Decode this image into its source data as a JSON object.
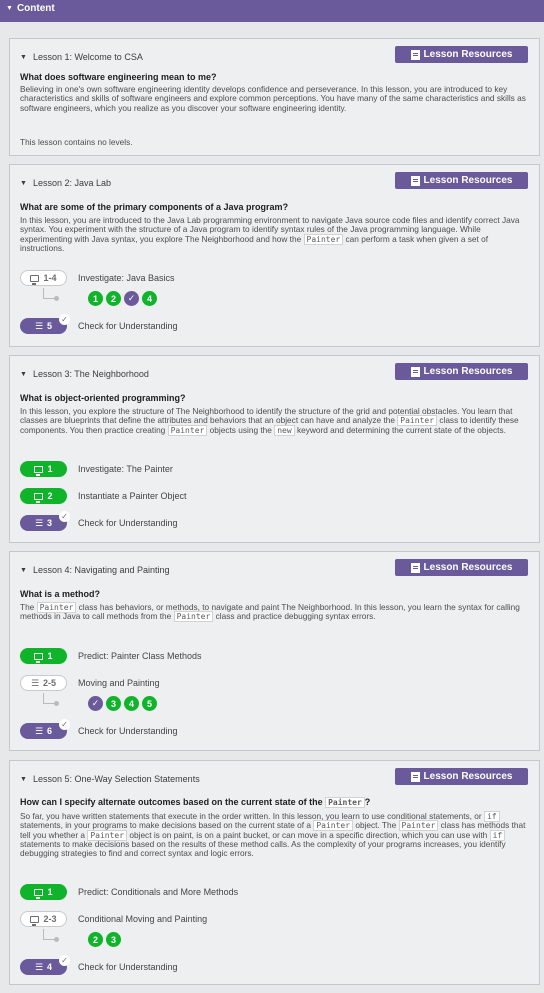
{
  "content_label": "Content",
  "resources_label": "Lesson Resources",
  "lessons": [
    {
      "title": "Lesson 1: Welcome to CSA",
      "question": "What does software engineering mean to me?",
      "description": "Believing in one's own software engineering identity develops confidence and perseverance. In this lesson, you are introduced to key characteristics and skills of software engineers and explore common perceptions. You have many of the same characteristics and skills as software engineers, which you realize as you discover your software engineering identity.",
      "no_levels": "This lesson contains no levels."
    },
    {
      "title": "Lesson 2: Java Lab",
      "question": "What are some of the primary components of a Java program?",
      "desc_a": "In this lesson, you are introduced to the Java Lab programming environment to navigate Java source code files and identify correct Java syntax. You experiment with the structure of a Java program to identify syntax rules of the Java programming language. While experimenting with Java syntax, you explore The Neighborhood and how the ",
      "code_a": "Painter",
      "desc_b": " can perform a task when given a set of instructions.",
      "levels": [
        {
          "badge": "1-4",
          "label": "Investigate: Java Basics"
        },
        {
          "badge": "5",
          "label": "Check for Understanding"
        }
      ],
      "bubbles": [
        "1",
        "2",
        "✓",
        "4"
      ]
    },
    {
      "title": "Lesson 3: The Neighborhood",
      "question": "What is object-oriented programming?",
      "desc_a": "In this lesson, you explore the structure of The Neighborhood to identify the structure of the grid and potential obstacles. You learn that classes are blueprints that define the attributes and behaviors that an object can have and analyze the ",
      "code_a": "Painter",
      "desc_b": " class to identify these components. You then practice creating ",
      "code_b": "Painter",
      "desc_c": " objects using the ",
      "code_c": "new",
      "desc_d": " keyword and determining the current state of the objects.",
      "levels": [
        {
          "badge": "1",
          "label": "Investigate: The Painter"
        },
        {
          "badge": "2",
          "label": "Instantiate a Painter Object"
        },
        {
          "badge": "3",
          "label": "Check for Understanding"
        }
      ]
    },
    {
      "title": "Lesson 4: Navigating and Painting",
      "question": "What is a method?",
      "desc_a": "The ",
      "code_a": "Painter",
      "desc_b": " class has behaviors, or methods, to navigate and paint The Neighborhood. In this lesson, you learn the syntax for calling methods in Java to call methods from the ",
      "code_b": "Painter",
      "desc_c": " class and practice debugging syntax errors.",
      "levels": [
        {
          "badge": "1",
          "label": "Predict: Painter Class Methods"
        },
        {
          "badge": "2-5",
          "label": "Moving and Painting"
        },
        {
          "badge": "6",
          "label": "Check for Understanding"
        }
      ],
      "bubbles": [
        "✓",
        "3",
        "4",
        "5"
      ]
    },
    {
      "title": "Lesson 5: One-Way Selection Statements",
      "question_a": "How can I specify alternate outcomes based on the current state of the ",
      "question_code": "Painter",
      "question_b": "?",
      "desc_a": "So far, you have written statements that execute in the order written. In this lesson, you learn to use conditional statements, or ",
      "code_a": "if",
      "desc_b": " statements, in your programs to make decisions based on the current state of a ",
      "code_b": "Painter",
      "desc_c": " object. The ",
      "code_c": "Painter",
      "desc_d": " class has methods that tell you whether a ",
      "code_d": "Painter",
      "desc_e": " object is on paint, is on a paint bucket, or can move in a specific direction, which you can use with ",
      "code_e": "if",
      "desc_f": " statements to make decisions based on the results of these method calls. As the complexity of your programs increases, you identify debugging strategies to find and correct syntax and logic errors.",
      "levels": [
        {
          "badge": "1",
          "label": "Predict: Conditionals and More Methods"
        },
        {
          "badge": "2-3",
          "label": "Conditional Moving and Painting"
        },
        {
          "badge": "4",
          "label": "Check for Understanding"
        }
      ],
      "bubbles": [
        "2",
        "3"
      ]
    }
  ],
  "colors": {
    "accent": "#6a5a9b",
    "success": "#0fb42a"
  }
}
